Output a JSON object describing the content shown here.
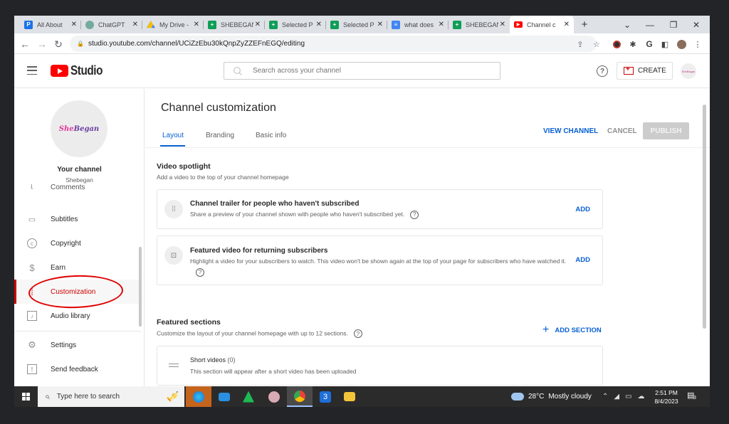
{
  "browser": {
    "tabs": [
      {
        "label": "All About",
        "icon": "p-icon",
        "color": "#1a73e8"
      },
      {
        "label": "ChatGPT",
        "icon": "chatgpt-icon",
        "color": "#74aa9c"
      },
      {
        "label": "My Drive -",
        "icon": "drive-icon",
        "color": "#fbbc04"
      },
      {
        "label": "SHEBEGAN",
        "icon": "sheets-icon",
        "color": "#0f9d58"
      },
      {
        "label": "Selected P",
        "icon": "sheets-icon",
        "color": "#0f9d58"
      },
      {
        "label": "Selected P",
        "icon": "sheets-icon",
        "color": "#0f9d58"
      },
      {
        "label": "what does",
        "icon": "docs-icon",
        "color": "#4285f4"
      },
      {
        "label": "SHEBEGAN",
        "icon": "sheets-icon",
        "color": "#0f9d58"
      },
      {
        "label": "Channel c",
        "icon": "youtube-icon",
        "color": "#ff0000",
        "active": true
      }
    ],
    "url": "studio.youtube.com/channel/UCiZzEbu30kQnpZyZZEFnEGQ/editing"
  },
  "header": {
    "logo_text": "Studio",
    "search_placeholder": "Search across your channel",
    "create_label": "CREATE",
    "avatar_text": "SheBegan"
  },
  "sidebar": {
    "avatar_she": "She",
    "avatar_began": "Began",
    "your_channel_label": "Your channel",
    "channel_name": "Shebegan",
    "items": [
      {
        "label": "Comments",
        "icon": "comments-icon",
        "glyph": "☐"
      },
      {
        "label": "Subtitles",
        "icon": "subtitles-icon",
        "glyph": "▭"
      },
      {
        "label": "Copyright",
        "icon": "copyright-icon",
        "glyph": "©"
      },
      {
        "label": "Earn",
        "icon": "dollar-icon",
        "glyph": "$"
      },
      {
        "label": "Customization",
        "icon": "customization-icon",
        "glyph": "⁞",
        "active": true
      },
      {
        "label": "Audio library",
        "icon": "audio-library-icon",
        "glyph": "♪"
      },
      {
        "label": "Settings",
        "icon": "gear-icon",
        "glyph": "⚙"
      },
      {
        "label": "Send feedback",
        "icon": "feedback-icon",
        "glyph": "!"
      }
    ]
  },
  "main": {
    "title": "Channel customization",
    "tabs": [
      {
        "label": "Layout",
        "active": true
      },
      {
        "label": "Branding"
      },
      {
        "label": "Basic info"
      }
    ],
    "view_channel_label": "VIEW CHANNEL",
    "cancel_label": "CANCEL",
    "publish_label": "PUBLISH",
    "video_spotlight": {
      "title": "Video spotlight",
      "description": "Add a video to the top of your channel homepage",
      "cards": [
        {
          "title": "Channel trailer for people who haven't subscribed",
          "description": "Share a preview of your channel shown with people who haven't subscribed yet.",
          "action": "ADD"
        },
        {
          "title": "Featured video for returning subscribers",
          "description": "Highlight a video for your subscribers to watch. This video won't be shown again at the top of your page for subscribers who have watched it.",
          "action": "ADD"
        }
      ]
    },
    "featured_sections": {
      "title": "Featured sections",
      "description": "Customize the layout of your channel homepage with up to 12 sections.",
      "add_label": "ADD SECTION",
      "sections": [
        {
          "title": "Short videos",
          "count": "(0)",
          "description": "This section will appear after a short video has been uploaded"
        }
      ]
    }
  },
  "taskbar": {
    "search_placeholder": "Type here to search",
    "weather_temp": "28°C",
    "weather_desc": "Mostly cloudy",
    "time": "2:51 PM",
    "date": "8/4/2023",
    "notification_count": "3"
  }
}
